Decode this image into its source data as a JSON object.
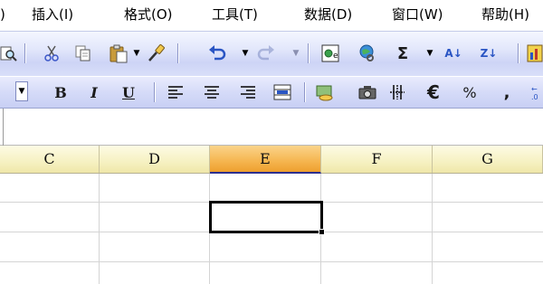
{
  "menubar": {
    "edge": ")",
    "insert": "插入(I)",
    "format": "格式(O)",
    "tools": "工具(T)",
    "data": "数据(D)",
    "window": "窗口(W)",
    "help": "帮助(H)"
  },
  "standard_toolbar": {
    "sigma": "Σ",
    "sort_asc": "A↓",
    "sort_desc": "Z↓"
  },
  "formatting_toolbar": {
    "bold": "B",
    "italic": "I",
    "underline": "U",
    "euro": "€",
    "percent": "%",
    "comma": ","
  },
  "columns": [
    "C",
    "D",
    "E",
    "F",
    "G"
  ],
  "active_column": "E",
  "colors": {
    "toolbar_blue": "#cdd4f6",
    "header_yellow": "#f6f1c2",
    "active_header_orange": "#f5b54f",
    "selection_border": "#000000"
  }
}
